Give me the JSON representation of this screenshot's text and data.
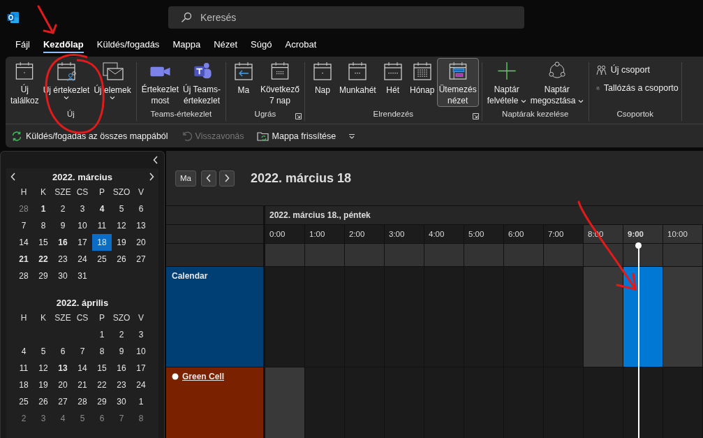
{
  "search": {
    "placeholder": "Keresés"
  },
  "menu": [
    {
      "label": "Fájl",
      "selected": false
    },
    {
      "label": "Kezdőlap",
      "selected": true
    },
    {
      "label": "Küldés/fogadás",
      "selected": false
    },
    {
      "label": "Mappa",
      "selected": false
    },
    {
      "label": "Nézet",
      "selected": false
    },
    {
      "label": "Súgó",
      "selected": false
    },
    {
      "label": "Acrobat",
      "selected": false
    }
  ],
  "ribbon": [
    {
      "label": "Új",
      "launcher": false,
      "buttons": [
        {
          "label": "Új\ntalálkoz",
          "selected": false
        },
        {
          "label": "Új értekezlet",
          "dropdown_below": true,
          "selected": false
        },
        {
          "label": "Új elemek",
          "dropdown_below": true,
          "selected": false
        }
      ]
    },
    {
      "label": "Teams-értekezlet",
      "launcher": false,
      "buttons": [
        {
          "label": "Értekezlet\nmost",
          "selected": false
        },
        {
          "label": "Új Teams-\nértekezlet",
          "selected": false
        }
      ]
    },
    {
      "label": "Ugrás",
      "launcher": true,
      "buttons": [
        {
          "label": "Ma",
          "selected": false
        },
        {
          "label": "Következő\n7 nap",
          "selected": false
        }
      ]
    },
    {
      "label": "Elrendezés",
      "launcher": true,
      "buttons": [
        {
          "label": "Nap",
          "selected": false
        },
        {
          "label": "Munkahét",
          "selected": false
        },
        {
          "label": "Hét",
          "selected": false
        },
        {
          "label": "Hónap",
          "selected": false
        },
        {
          "label": "Ütemezés\nnézet",
          "selected": true
        }
      ]
    },
    {
      "label": "Naptárak kezelése",
      "launcher": false,
      "buttons": [
        {
          "label": "Naptár\nfelvétele",
          "dropdown_inline": true,
          "selected": false
        },
        {
          "label": "Naptár\nmegosztása",
          "dropdown_inline": true,
          "selected": false
        }
      ]
    },
    {
      "label": "Csoportok",
      "launcher": false,
      "small_buttons": [
        {
          "label": "Új csoport"
        },
        {
          "label": "Tallózás a csoporto"
        }
      ]
    }
  ],
  "quick_bar": [
    {
      "label": "Küldés/fogadás az összes mappából",
      "disabled": false
    },
    {
      "label": "Visszavonás",
      "disabled": true
    },
    {
      "label": "Mappa frissítése",
      "disabled": false
    }
  ],
  "mini_calendar": {
    "months": [
      {
        "title": "2022. március",
        "weekdays": [
          "H",
          "K",
          "SZE",
          "CS",
          "P",
          "SZO",
          "V"
        ],
        "weeks": [
          [
            {
              "d": "28",
              "kind": "other"
            },
            {
              "d": "1",
              "kind": "busy"
            },
            {
              "d": "2",
              "kind": "plain"
            },
            {
              "d": "3",
              "kind": "plain"
            },
            {
              "d": "4",
              "kind": "busy"
            },
            {
              "d": "5",
              "kind": "plain"
            },
            {
              "d": "6",
              "kind": "plain"
            }
          ],
          [
            {
              "d": "7",
              "kind": "plain"
            },
            {
              "d": "8",
              "kind": "plain"
            },
            {
              "d": "9",
              "kind": "plain"
            },
            {
              "d": "10",
              "kind": "plain"
            },
            {
              "d": "11",
              "kind": "plain"
            },
            {
              "d": "12",
              "kind": "plain"
            },
            {
              "d": "13",
              "kind": "plain"
            }
          ],
          [
            {
              "d": "14",
              "kind": "plain"
            },
            {
              "d": "15",
              "kind": "plain"
            },
            {
              "d": "16",
              "kind": "busy"
            },
            {
              "d": "17",
              "kind": "plain"
            },
            {
              "d": "18",
              "kind": "today"
            },
            {
              "d": "19",
              "kind": "plain"
            },
            {
              "d": "20",
              "kind": "plain"
            }
          ],
          [
            {
              "d": "21",
              "kind": "busy"
            },
            {
              "d": "22",
              "kind": "busy"
            },
            {
              "d": "23",
              "kind": "plain"
            },
            {
              "d": "24",
              "kind": "plain"
            },
            {
              "d": "25",
              "kind": "plain"
            },
            {
              "d": "26",
              "kind": "plain"
            },
            {
              "d": "27",
              "kind": "plain"
            }
          ],
          [
            {
              "d": "28",
              "kind": "plain"
            },
            {
              "d": "29",
              "kind": "plain"
            },
            {
              "d": "30",
              "kind": "plain"
            },
            {
              "d": "31",
              "kind": "plain"
            }
          ]
        ]
      },
      {
        "title": "2022. április",
        "weekdays": [
          "H",
          "K",
          "SZE",
          "CS",
          "P",
          "SZO",
          "V"
        ],
        "weeks": [
          [
            {
              "d": "1",
              "kind": "plain"
            },
            {
              "d": "2",
              "kind": "plain"
            },
            {
              "d": "3",
              "kind": "plain"
            }
          ],
          [
            {
              "d": "4",
              "kind": "plain"
            },
            {
              "d": "5",
              "kind": "plain"
            },
            {
              "d": "6",
              "kind": "plain"
            },
            {
              "d": "7",
              "kind": "plain"
            },
            {
              "d": "8",
              "kind": "plain"
            },
            {
              "d": "9",
              "kind": "plain"
            },
            {
              "d": "10",
              "kind": "plain"
            }
          ],
          [
            {
              "d": "11",
              "kind": "plain"
            },
            {
              "d": "12",
              "kind": "plain"
            },
            {
              "d": "13",
              "kind": "busy"
            },
            {
              "d": "14",
              "kind": "plain"
            },
            {
              "d": "15",
              "kind": "plain"
            },
            {
              "d": "16",
              "kind": "plain"
            },
            {
              "d": "17",
              "kind": "plain"
            }
          ],
          [
            {
              "d": "18",
              "kind": "plain"
            },
            {
              "d": "19",
              "kind": "plain"
            },
            {
              "d": "20",
              "kind": "plain"
            },
            {
              "d": "21",
              "kind": "plain"
            },
            {
              "d": "22",
              "kind": "plain"
            },
            {
              "d": "23",
              "kind": "plain"
            },
            {
              "d": "24",
              "kind": "plain"
            }
          ],
          [
            {
              "d": "25",
              "kind": "plain"
            },
            {
              "d": "26",
              "kind": "plain"
            },
            {
              "d": "27",
              "kind": "plain"
            },
            {
              "d": "28",
              "kind": "plain"
            },
            {
              "d": "29",
              "kind": "plain"
            },
            {
              "d": "30",
              "kind": "plain"
            },
            {
              "d": "1",
              "kind": "plain"
            }
          ],
          [
            {
              "d": "2",
              "kind": "other"
            },
            {
              "d": "3",
              "kind": "other"
            },
            {
              "d": "4",
              "kind": "other"
            },
            {
              "d": "5",
              "kind": "other"
            },
            {
              "d": "6",
              "kind": "other"
            },
            {
              "d": "7",
              "kind": "other"
            },
            {
              "d": "8",
              "kind": "other"
            }
          ]
        ]
      }
    ]
  },
  "schedule": {
    "today_button": "Ma",
    "title": "2022. március 18",
    "day_header": "2022. március 18., péntek",
    "hours": [
      {
        "label": "0:00",
        "working": false,
        "now": false
      },
      {
        "label": "1:00",
        "working": false,
        "now": false
      },
      {
        "label": "2:00",
        "working": false,
        "now": false
      },
      {
        "label": "3:00",
        "working": false,
        "now": false
      },
      {
        "label": "4:00",
        "working": false,
        "now": false
      },
      {
        "label": "5:00",
        "working": false,
        "now": false
      },
      {
        "label": "6:00",
        "working": false,
        "now": false
      },
      {
        "label": "7:00",
        "working": false,
        "now": false
      },
      {
        "label": "8:00",
        "working": true,
        "now": false
      },
      {
        "label": "9:00",
        "working": true,
        "now": true
      },
      {
        "label": "10:00",
        "working": true,
        "now": false
      }
    ],
    "rows": [
      {
        "name": "Calendar",
        "shared": false,
        "color": "#003f73",
        "cells": [
          {
            "working": false,
            "selected": false
          },
          {
            "working": false,
            "selected": false
          },
          {
            "working": false,
            "selected": false
          },
          {
            "working": false,
            "selected": false
          },
          {
            "working": false,
            "selected": false
          },
          {
            "working": false,
            "selected": false
          },
          {
            "working": false,
            "selected": false
          },
          {
            "working": false,
            "selected": false
          },
          {
            "working": true,
            "selected": false
          },
          {
            "working": true,
            "selected": true
          },
          {
            "working": true,
            "selected": false
          }
        ]
      },
      {
        "name": "Green Cell",
        "shared": true,
        "color": "#7a2200",
        "cells": [
          {
            "working": true,
            "selected": false
          },
          {
            "working": false,
            "selected": false
          },
          {
            "working": false,
            "selected": false
          },
          {
            "working": false,
            "selected": false
          },
          {
            "working": false,
            "selected": false
          },
          {
            "working": false,
            "selected": false
          },
          {
            "working": false,
            "selected": false
          },
          {
            "working": false,
            "selected": false
          },
          {
            "working": false,
            "selected": false
          },
          {
            "working": false,
            "selected": false
          },
          {
            "working": false,
            "selected": false
          }
        ]
      }
    ]
  }
}
